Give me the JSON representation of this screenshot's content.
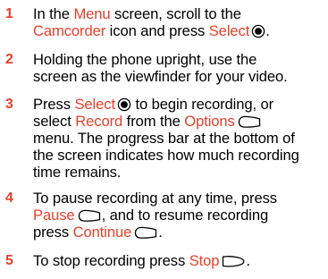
{
  "steps": [
    {
      "number": "1",
      "parts": [
        {
          "text": "In the ",
          "hl": false
        },
        {
          "text": "Menu",
          "hl": true
        },
        {
          "text": " screen, scroll to the ",
          "hl": false
        },
        {
          "br": true
        },
        {
          "text": "Camcorder",
          "hl": true
        },
        {
          "text": " icon and press ",
          "hl": false
        },
        {
          "text": "Select",
          "hl": true
        },
        {
          "icon": "select-key-icon"
        },
        {
          "text": ".",
          "hl": false
        }
      ]
    },
    {
      "number": "2",
      "parts": [
        {
          "text": "Holding the phone upright, use the",
          "hl": false
        },
        {
          "br": true
        },
        {
          "text": "screen as the viewfinder for your video.",
          "hl": false
        }
      ]
    },
    {
      "number": "3",
      "parts": [
        {
          "text": "Press ",
          "hl": false
        },
        {
          "text": "Select",
          "hl": true
        },
        {
          "icon": "select-key-icon"
        },
        {
          "text": " to begin recording, or",
          "hl": false
        },
        {
          "br": true
        },
        {
          "text": "select ",
          "hl": false
        },
        {
          "text": "Record",
          "hl": true
        },
        {
          "text": " from the ",
          "hl": false
        },
        {
          "text": "Options",
          "hl": true
        },
        {
          "icon": "left-soft-key-icon"
        },
        {
          "br": true
        },
        {
          "text": "menu. The progress bar at the bottom of",
          "hl": false
        },
        {
          "br": true
        },
        {
          "text": "the screen indicates how much recording",
          "hl": false
        },
        {
          "br": true
        },
        {
          "text": "time remains.",
          "hl": false
        }
      ]
    },
    {
      "number": "4",
      "parts": [
        {
          "text": "To pause recording at any time, press",
          "hl": false
        },
        {
          "br": true
        },
        {
          "text": "Pause",
          "hl": true
        },
        {
          "icon": "left-soft-key-icon"
        },
        {
          "text": ", and to resume recording",
          "hl": false
        },
        {
          "br": true
        },
        {
          "text": "press ",
          "hl": false
        },
        {
          "text": "Continue",
          "hl": true
        },
        {
          "icon": "left-soft-key-icon"
        },
        {
          "text": ".",
          "hl": false
        }
      ]
    },
    {
      "number": "5",
      "parts": [
        {
          "text": "To stop recording press ",
          "hl": false
        },
        {
          "text": "Stop",
          "hl": true
        },
        {
          "icon": "right-soft-key-icon"
        },
        {
          "text": ".",
          "hl": false
        }
      ]
    }
  ]
}
